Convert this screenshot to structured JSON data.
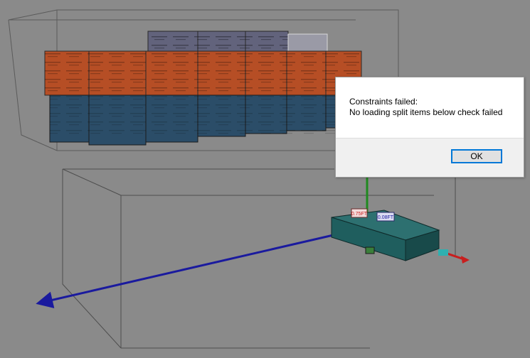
{
  "dialog": {
    "line1": "Constraints failed:",
    "line2": "No loading split items below check failed",
    "ok_label": "OK"
  },
  "scene": {
    "item_label_red": "0.75FT",
    "item_label_blue": "0.08FT",
    "colors": {
      "background": "#8a8a8a",
      "orange_box": "#b64e25",
      "blue_box": "#2b4d68",
      "purple_box": "#62637c",
      "teal_item": "#1f5e5e",
      "axis_blue": "#1a1a9e",
      "axis_green": "#1f8a1f",
      "axis_red": "#c81e1e"
    }
  }
}
